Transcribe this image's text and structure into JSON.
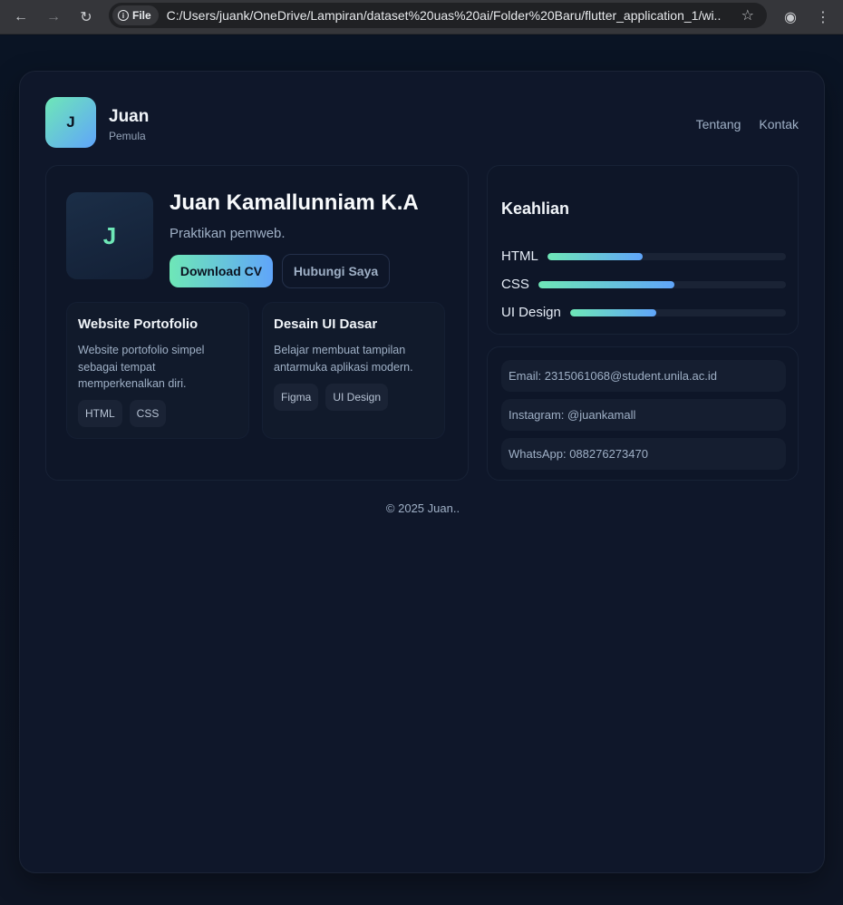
{
  "browser": {
    "back_icon": "←",
    "forward_icon": "→",
    "reload_icon": "↻",
    "security_icon": "i",
    "scheme_label": "File",
    "url": "C:/Users/juank/OneDrive/Lampiran/dataset%20uas%20ai/Folder%20Baru/flutter_application_1/wi...",
    "star_icon": "☆",
    "profile_icon": "◉",
    "menu_icon": "⋮"
  },
  "header": {
    "logo_letter": "J",
    "name": "Juan",
    "role": "Pemula",
    "nav": [
      "Tentang",
      "Kontak"
    ]
  },
  "hero": {
    "avatar_letter": "J",
    "name": "Juan Kamallunniam K.A",
    "tagline": "Praktikan pemweb.",
    "primary_button": "Download CV",
    "secondary_button": "Hubungi Saya"
  },
  "projects": [
    {
      "title": "Website Portofolio",
      "description": "Website portofolio simpel sebagai tempat memperkenalkan diri.",
      "tags": [
        "HTML",
        "CSS"
      ]
    },
    {
      "title": "Desain UI Dasar",
      "description": "Belajar membuat tampilan antarmuka aplikasi modern.",
      "tags": [
        "Figma",
        "UI Design"
      ]
    }
  ],
  "skills": {
    "title": "Keahlian",
    "items": [
      {
        "label": "HTML",
        "level": 0.4
      },
      {
        "label": "CSS",
        "level": 0.55
      },
      {
        "label": "UI Design",
        "level": 0.4
      }
    ]
  },
  "contact": {
    "items": [
      "Email: 2315061068@student.unila.ac.id",
      "Instagram: @juankamall",
      "WhatsApp: 088276273470"
    ]
  },
  "footer": {
    "text": "© 2025 Juan.."
  },
  "colors": {
    "accent_start": "#6ee7b7",
    "accent_end": "#60a5fa",
    "background": "#0f172a"
  }
}
